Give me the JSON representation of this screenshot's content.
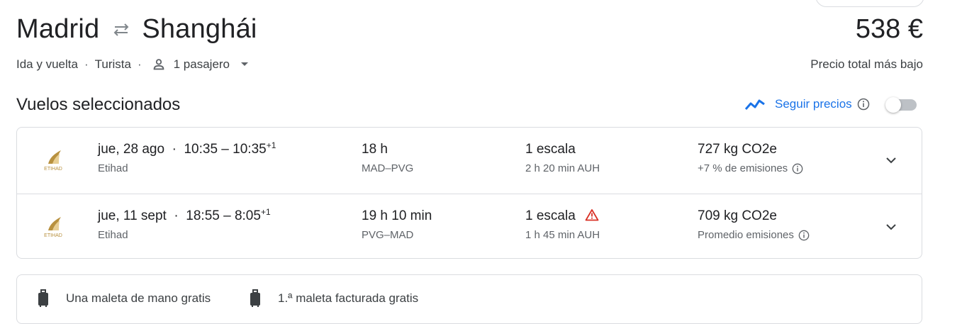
{
  "header": {
    "origin": "Madrid",
    "destination": "Shanghái",
    "price": "538 €",
    "price_note": "Precio total más bajo",
    "trip_type": "Ida y vuelta",
    "cabin": "Turista",
    "passengers": "1 pasajero"
  },
  "section": {
    "title": "Vuelos seleccionados",
    "track_label": "Seguir precios",
    "track_enabled": false
  },
  "flights": [
    {
      "date": "jue, 28 ago",
      "times": "10:35 – 10:35",
      "day_offset": "+1",
      "airline": "Etihad",
      "duration": "18 h",
      "route": "MAD–PVG",
      "stops": "1 escala",
      "layover": "2 h 20 min AUH",
      "emissions": "727 kg CO2e",
      "emissions_note": "+7 % de emisiones",
      "warning": false
    },
    {
      "date": "jue, 11 sept",
      "times": "18:55 – 8:05",
      "day_offset": "+1",
      "airline": "Etihad",
      "duration": "19 h 10 min",
      "route": "PVG–MAD",
      "stops": "1 escala",
      "layover": "1 h 45 min AUH",
      "emissions": "709 kg CO2e",
      "emissions_note": "Promedio emisiones",
      "warning": true
    }
  ],
  "baggage": {
    "carry_on": "Una maleta de mano gratis",
    "checked": "1.ª maleta facturada gratis"
  },
  "logo_text": "ETIHAD",
  "colors": {
    "accent": "#1a73e8",
    "warning": "#d93025",
    "etihad_gold": "#b8913f",
    "border": "#dadce0"
  },
  "icons": [
    "swap-icon",
    "person-icon",
    "dropdown-caret-icon",
    "price-trend-icon",
    "info-icon",
    "warning-icon",
    "chevron-down-icon",
    "luggage-icon",
    "etihad-logo"
  ]
}
